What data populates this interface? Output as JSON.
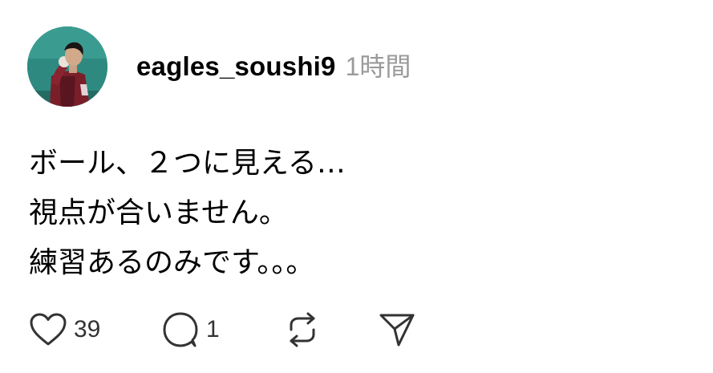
{
  "post": {
    "username": "eagles_soushi9",
    "time": "1時間",
    "lines": [
      "ボール、２つに見える…",
      "視点が合いません。",
      "練習あるのみです。。。"
    ]
  },
  "actions": {
    "like_icon": "heart-icon",
    "like_count": "39",
    "comment_icon": "speech-bubble-icon",
    "comment_count": "1",
    "repost_icon": "repost-arrows-icon",
    "share_icon": "paper-plane-icon"
  },
  "colors": {
    "text": "#000000",
    "muted": "#9a9a9a",
    "icon": "#333333"
  }
}
